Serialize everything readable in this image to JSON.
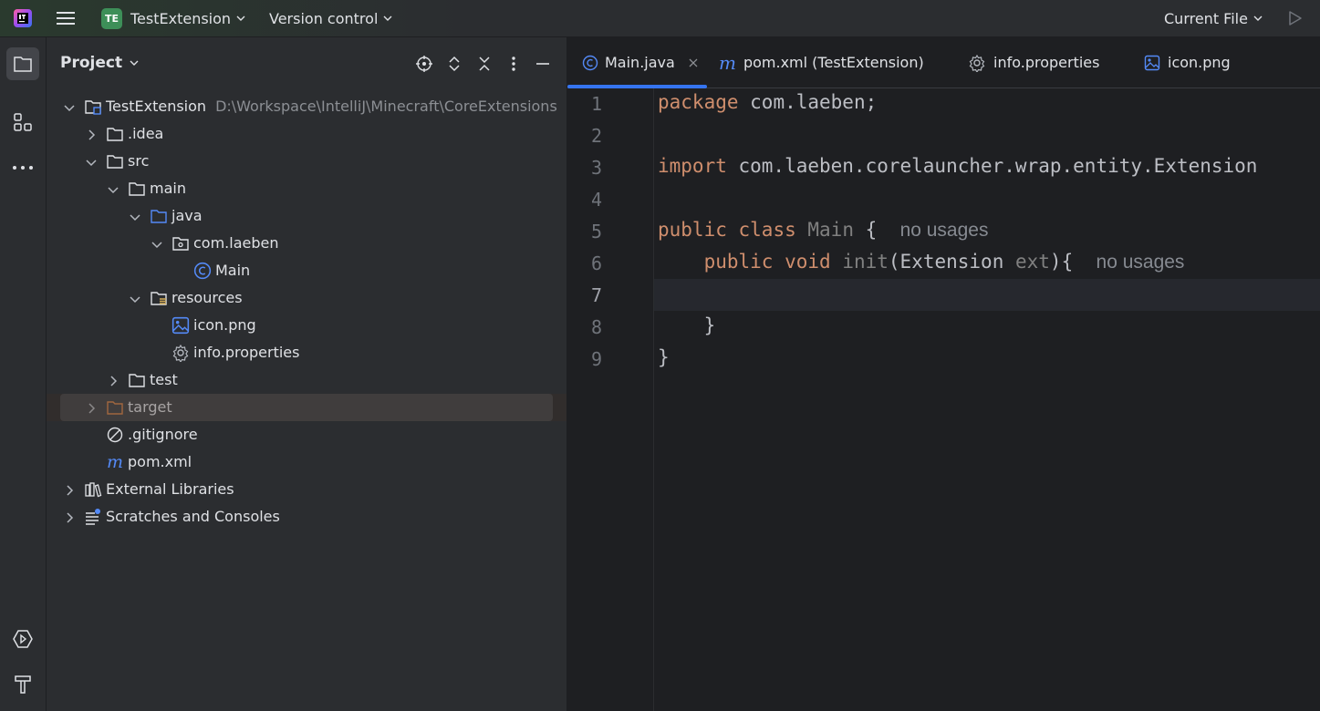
{
  "titlebar": {
    "project_badge": "TE",
    "project_name": "TestExtension",
    "vcs_label": "Version control",
    "run_config": "Current File"
  },
  "project_panel": {
    "title": "Project",
    "tree": [
      {
        "label": "TestExtension",
        "sub": "D:\\Workspace\\IntelliJ\\Minecraft\\CoreExtensions",
        "icon": "module-folder-icon",
        "expanded": true
      },
      {
        "label": ".idea",
        "icon": "folder-icon",
        "expanded": false
      },
      {
        "label": "src",
        "icon": "folder-icon",
        "expanded": true
      },
      {
        "label": "main",
        "icon": "folder-icon",
        "expanded": true
      },
      {
        "label": "java",
        "icon": "source-folder-icon",
        "expanded": true
      },
      {
        "label": "com.laeben",
        "icon": "package-icon",
        "expanded": true
      },
      {
        "label": "Main",
        "icon": "java-class-icon"
      },
      {
        "label": "resources",
        "icon": "resources-folder-icon",
        "expanded": true
      },
      {
        "label": "icon.png",
        "icon": "image-file-icon"
      },
      {
        "label": "info.properties",
        "icon": "properties-file-icon"
      },
      {
        "label": "test",
        "icon": "folder-icon",
        "expanded": false
      },
      {
        "label": "target",
        "icon": "excluded-folder-icon",
        "expanded": false,
        "selected": true
      },
      {
        "label": ".gitignore",
        "icon": "gitignore-icon"
      },
      {
        "label": "pom.xml",
        "icon": "maven-icon"
      },
      {
        "label": "External Libraries",
        "icon": "libraries-icon",
        "expanded": false
      },
      {
        "label": "Scratches and Consoles",
        "icon": "scratches-icon",
        "expanded": false
      }
    ]
  },
  "editor": {
    "tabs": [
      {
        "label": "Main.java",
        "icon": "java-class-icon",
        "active": true,
        "closable": true
      },
      {
        "label": "pom.xml (TestExtension)",
        "icon": "maven-icon"
      },
      {
        "label": "info.properties",
        "icon": "properties-file-icon"
      },
      {
        "label": "icon.png",
        "icon": "image-file-icon"
      }
    ],
    "current_line": 7,
    "line_numbers": [
      "1",
      "2",
      "3",
      "4",
      "5",
      "6",
      "7",
      "8",
      "9"
    ],
    "code": {
      "l1_kw": "package",
      "l1_rest": " com.laeben;",
      "l3_kw": "import",
      "l3_rest": " com.laeben.corelauncher.wrap.entity.Extension",
      "l5_kw1": "public",
      "l5_kw2": "class",
      "l5_name": "Main",
      "l5_brace": " {",
      "l5_hint": "no usages",
      "l6_kw1": "public",
      "l6_kw2": "void",
      "l6_name": "init",
      "l6_open": "(Extension ",
      "l6_param": "ext",
      "l6_close": "){",
      "l6_hint": "no usages",
      "l8_brace": "}",
      "l9_brace": "}"
    }
  },
  "colors": {
    "accent": "#3574f0",
    "keyword": "#cf8e6d",
    "badge": "#3d8f58"
  }
}
